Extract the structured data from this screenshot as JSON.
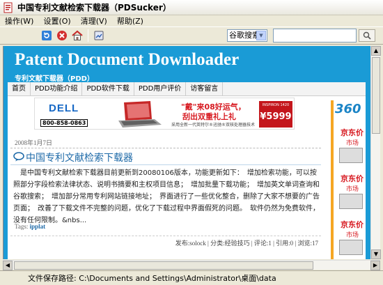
{
  "window": {
    "title": "中国专利文献检索下载器（PDSucker）"
  },
  "menu": {
    "items": [
      "操作(W)",
      "设置(O)",
      "清理(V)",
      "帮助(Z)"
    ]
  },
  "toolbar": {
    "buttons": [
      "refresh-icon",
      "stop-icon",
      "home-icon",
      "info-icon"
    ],
    "search_engine": "谷歌搜索",
    "search_value": ""
  },
  "page": {
    "site_title": "Patent Document Downloader",
    "site_subtitle": "专利文献下载器（PDD）",
    "nav": [
      "首页",
      "PDD功能介绍",
      "PDD软件下载",
      "PDD用户评价",
      "访客留言"
    ],
    "ad": {
      "brand": "DELL",
      "phone": "800-858-0863",
      "line1": "\"戴\"来08好运气，",
      "line2": "刮出双重礼上礼",
      "line3": "采用全新一代英特尔®迅驰®双核处理器技术",
      "price_label": "INSPIRON 1420 ",
      "price": "¥5999"
    },
    "post": {
      "date": "2008年1月7日",
      "title": "中国专利文献检索下载器",
      "body": "　是中国专利文献检索下载器目前更新到20080106版本，功能更新如下：　增加检索功能，可以按照部分字段检索法律状态、说明书摘要和主权项目信息；　增加批量下载功能；　增加英文单词查询和谷歌搜索；　增加部分常用专利网站链接地址；　界面进行了一些优化整合，删除了大家不想要的广告页面；　改善了下载文件不完整的问题，优化了下载过程中界面假死的问题。　软件仍然为免费软件，没有任何限制。&nbs...",
      "tags_label": "Tags:",
      "tag": "ipplat",
      "meta": "发布:solock | 分类:经验技巧  | 评论:1 | 引用:0 | 浏览:17"
    },
    "side_ad": {
      "brand": "360",
      "label1": "京东价",
      "label2": "市场",
      "label3": "京东价",
      "label4": "市场",
      "label5": "京东价",
      "label6": "市场"
    }
  },
  "status": {
    "label": "文件保存路径:  C:\\Documents and Settings\\Administrator\\桌面\\data"
  }
}
